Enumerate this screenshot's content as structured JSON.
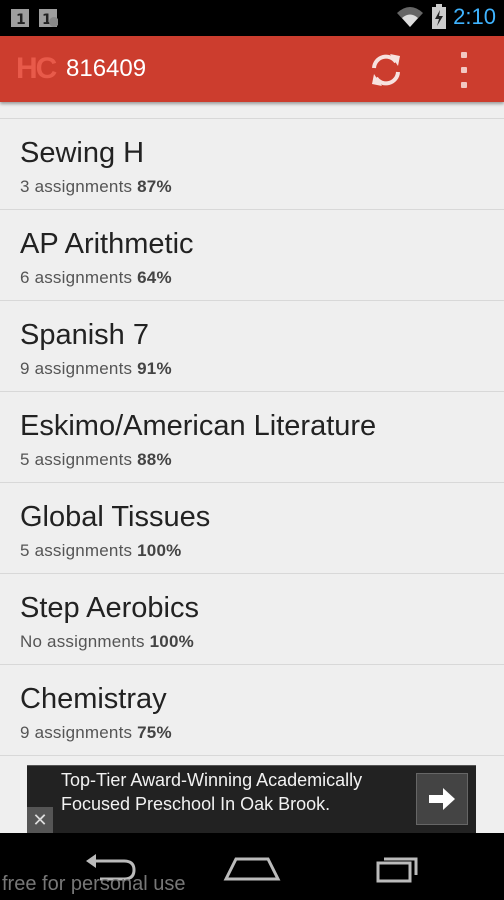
{
  "status_bar": {
    "time": "2:10",
    "notification_icons": [
      "sim-card-icon",
      "download-notification-icon"
    ],
    "system_icons": [
      "wifi-icon",
      "battery-charging-icon"
    ]
  },
  "action_bar": {
    "logo_text": "HC",
    "title": "816409",
    "refresh_icon": "refresh-icon",
    "overflow_icon": "overflow-menu-icon"
  },
  "courses": [
    {
      "name": "Sewing H",
      "assignments": "3 assignments",
      "grade": "87%"
    },
    {
      "name": "AP Arithmetic",
      "assignments": "6 assignments",
      "grade": "64%"
    },
    {
      "name": "Spanish 7",
      "assignments": "9 assignments",
      "grade": "91%"
    },
    {
      "name": "Eskimo/American Literature",
      "assignments": "5 assignments",
      "grade": "88%"
    },
    {
      "name": "Global Tissues",
      "assignments": "5 assignments",
      "grade": "100%"
    },
    {
      "name": "Step Aerobics",
      "assignments": "No assignments",
      "grade": "100%"
    },
    {
      "name": "Chemistray",
      "assignments": "9 assignments",
      "grade": "75%"
    }
  ],
  "ad": {
    "line1": "Top-Tier Award-Winning Academically",
    "line2": "Focused Preschool In Oak Brook.",
    "go_icon": "arrow-right-icon",
    "close_label": "✕"
  },
  "nav_bar": {
    "back_icon": "back-icon",
    "home_icon": "home-icon",
    "recents_icon": "recent-apps-icon"
  },
  "watermark": "free for personal use",
  "colors": {
    "action_bar": "#cc3d2e",
    "clock": "#3fb4ff",
    "list_bg": "#efefef"
  }
}
